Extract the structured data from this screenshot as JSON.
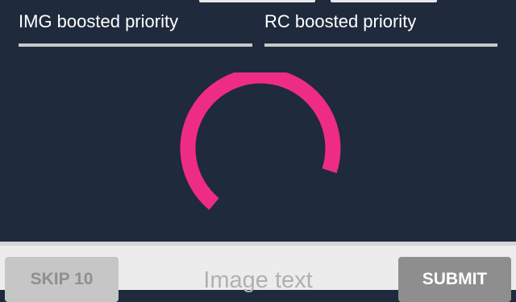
{
  "fields": {
    "img_label": "IMG boosted priority",
    "rc_label": "RC boosted priority"
  },
  "spinner": {
    "color": "#ef2c85",
    "track_color": "#1f2a3c"
  },
  "bottom_bar": {
    "skip_label": "SKIP 10",
    "input_placeholder": "Image text",
    "input_value": "",
    "submit_label": "SUBMIT"
  },
  "colors": {
    "background": "#1f2a3c",
    "underline": "#c9c9c9",
    "submit_bg": "#8e8e8e",
    "skip_bg": "#c6c6c6"
  }
}
